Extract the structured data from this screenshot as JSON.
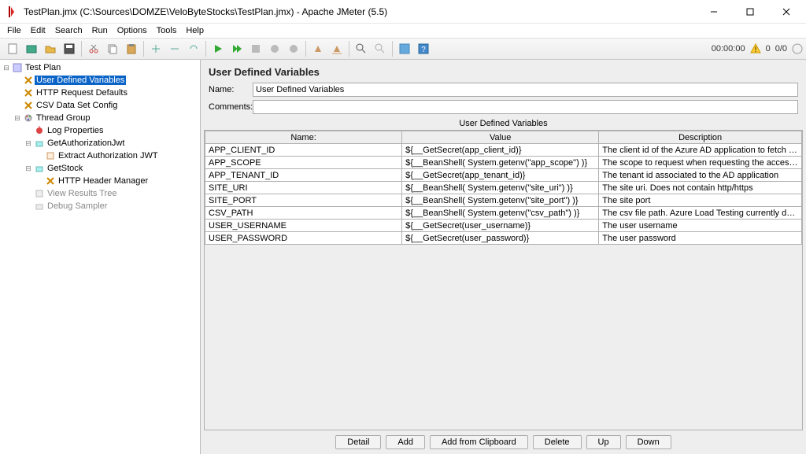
{
  "window": {
    "title": "TestPlan.jmx (C:\\Sources\\DOMZE\\VeloByteStocks\\TestPlan.jmx) - Apache JMeter (5.5)"
  },
  "menu": [
    "File",
    "Edit",
    "Search",
    "Run",
    "Options",
    "Tools",
    "Help"
  ],
  "status": {
    "time": "00:00:00",
    "warn": "0",
    "count": "0/0"
  },
  "tree": {
    "root": "Test Plan",
    "items": [
      {
        "label": "User Defined Variables",
        "selected": true
      },
      {
        "label": "HTTP Request Defaults"
      },
      {
        "label": "CSV Data Set Config"
      },
      {
        "label": "Thread Group",
        "children": [
          {
            "label": "Log Properties"
          },
          {
            "label": "GetAuthorizationJwt",
            "children": [
              {
                "label": "Extract Authorization JWT"
              }
            ]
          },
          {
            "label": "GetStock",
            "children": [
              {
                "label": "HTTP Header Manager"
              }
            ]
          },
          {
            "label": "View Results Tree",
            "dim": true
          },
          {
            "label": "Debug Sampler",
            "dim": true
          }
        ]
      }
    ]
  },
  "panel": {
    "title": "User Defined Variables",
    "labels": {
      "name": "Name:",
      "comments": "Comments:",
      "section": "User Defined Variables"
    },
    "name_value": "User Defined Variables",
    "comments_value": "",
    "columns": [
      "Name:",
      "Value",
      "Description"
    ],
    "rows": [
      {
        "n": "APP_CLIENT_ID",
        "v": "${__GetSecret(app_client_id)}",
        "d": "The client id of the Azure AD application to fetch the access token from"
      },
      {
        "n": "APP_SCOPE",
        "v": "${__BeanShell( System.getenv(\"app_scope\") )}",
        "d": "The scope to request when requesting the access token"
      },
      {
        "n": "APP_TENANT_ID",
        "v": "${__GetSecret(app_tenant_id)}",
        "d": "The tenant id associated to the AD application"
      },
      {
        "n": "SITE_URI",
        "v": "${__BeanShell( System.getenv(\"site_uri\") )}",
        "d": "The site uri. Does not contain http/https"
      },
      {
        "n": "SITE_PORT",
        "v": "${__BeanShell( System.getenv(\"site_port\") )}",
        "d": "The site port"
      },
      {
        "n": "CSV_PATH",
        "v": "${__BeanShell( System.getenv(\"csv_path\") )}",
        "d": "The csv file path. Azure Load Testing currently doesn't support the use of ..."
      },
      {
        "n": "USER_USERNAME",
        "v": "${__GetSecret(user_username)}",
        "d": "The user username"
      },
      {
        "n": "USER_PASSWORD",
        "v": "${__GetSecret(user_password)}",
        "d": "The user password"
      }
    ],
    "buttons": [
      "Detail",
      "Add",
      "Add from Clipboard",
      "Delete",
      "Up",
      "Down"
    ]
  }
}
